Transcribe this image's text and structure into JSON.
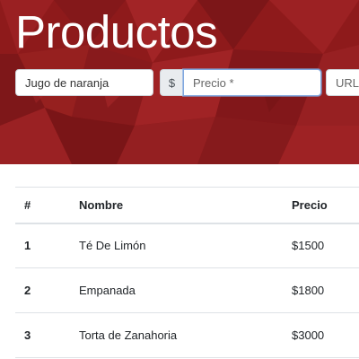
{
  "header": {
    "title": "Productos"
  },
  "form": {
    "name_value": "Jugo de naranja",
    "currency_symbol": "$",
    "price_placeholder": "Precio *",
    "url_placeholder": "URL"
  },
  "table": {
    "columns": [
      "#",
      "Nombre",
      "Precio"
    ],
    "rows": [
      {
        "num": "1",
        "name": "Té De Limón",
        "price": "$1500"
      },
      {
        "num": "2",
        "name": "Empanada",
        "price": "$1800"
      },
      {
        "num": "3",
        "name": "Torta de Zanahoria",
        "price": "$3000"
      }
    ]
  },
  "colors": {
    "hero_background": "#8e1a1b",
    "accent_focus": "#80a8e0"
  }
}
